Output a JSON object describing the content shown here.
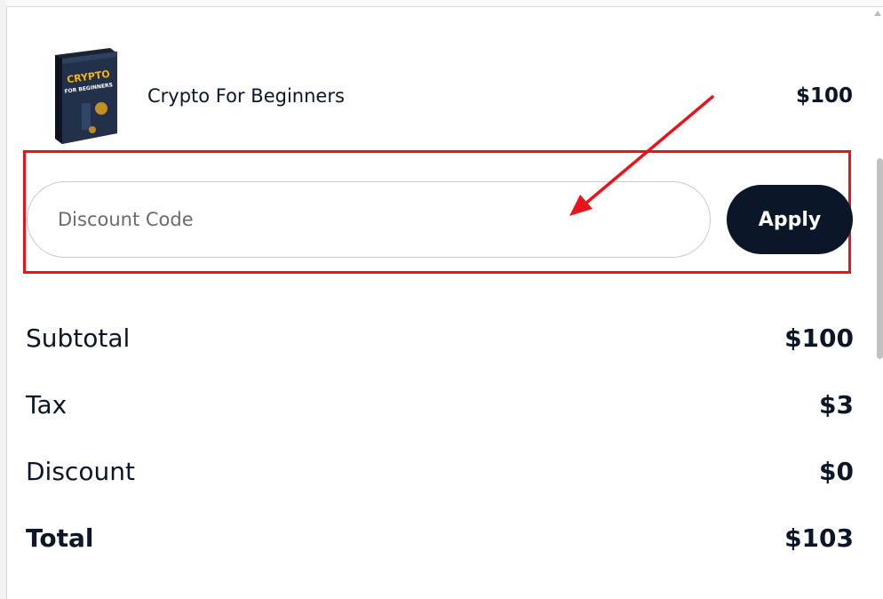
{
  "product": {
    "name": "Crypto For Beginners",
    "price": "$100",
    "image_title_line1": "CRYPTO",
    "image_title_line2": "FOR BEGINNERS"
  },
  "discount": {
    "placeholder": "Discount Code",
    "apply_label": "Apply"
  },
  "summary": {
    "subtotal": {
      "label": "Subtotal",
      "value": "$100"
    },
    "tax": {
      "label": "Tax",
      "value": "$3"
    },
    "discount": {
      "label": "Discount",
      "value": "$0"
    },
    "total": {
      "label": "Total",
      "value": "$103"
    }
  },
  "colors": {
    "primary_dark": "#0b1628",
    "annotation_red": "#e8141b",
    "input_border": "#c9c9c9"
  },
  "icons": {
    "annotation_arrow": "arrow-pointer-icon"
  }
}
